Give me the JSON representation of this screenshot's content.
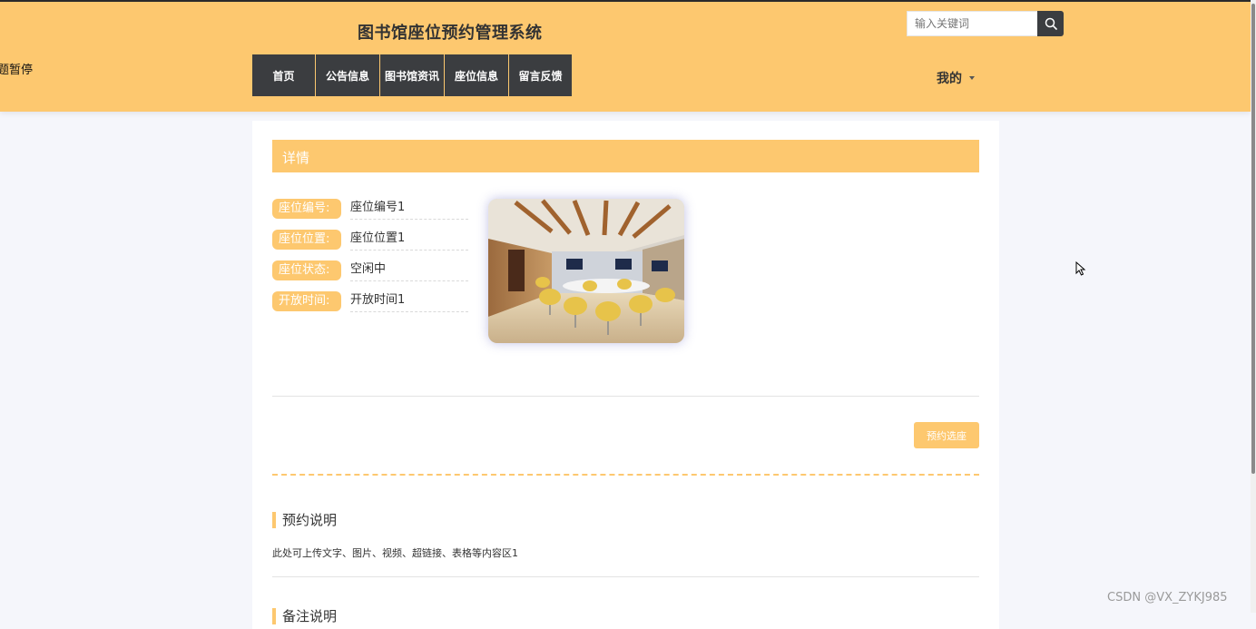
{
  "header": {
    "title": "图书馆座位预约管理系统",
    "marquee": "题暂停",
    "search": {
      "placeholder": "输入关键词"
    },
    "nav": [
      "首页",
      "公告信息",
      "图书馆资讯",
      "座位信息",
      "留言反馈"
    ],
    "user_menu": "我的"
  },
  "detail": {
    "heading": "详情",
    "fields": [
      {
        "label": "座位编号:",
        "value": "座位编号1"
      },
      {
        "label": "座位位置:",
        "value": "座位位置1"
      },
      {
        "label": "座位状态:",
        "value": "空闲中"
      },
      {
        "label": "开放时间:",
        "value": "开放时间1"
      }
    ],
    "reserve_button": "预约选座"
  },
  "sections": {
    "notice_title": "预约说明",
    "notice_text": "此处可上传文字、图片、视频、超链接、表格等内容区1",
    "next_title": "备注说明"
  },
  "watermark": "CSDN @VX_ZYKJ985",
  "colors": {
    "accent": "#fdc86f",
    "nav_bg": "#3b3d40"
  }
}
